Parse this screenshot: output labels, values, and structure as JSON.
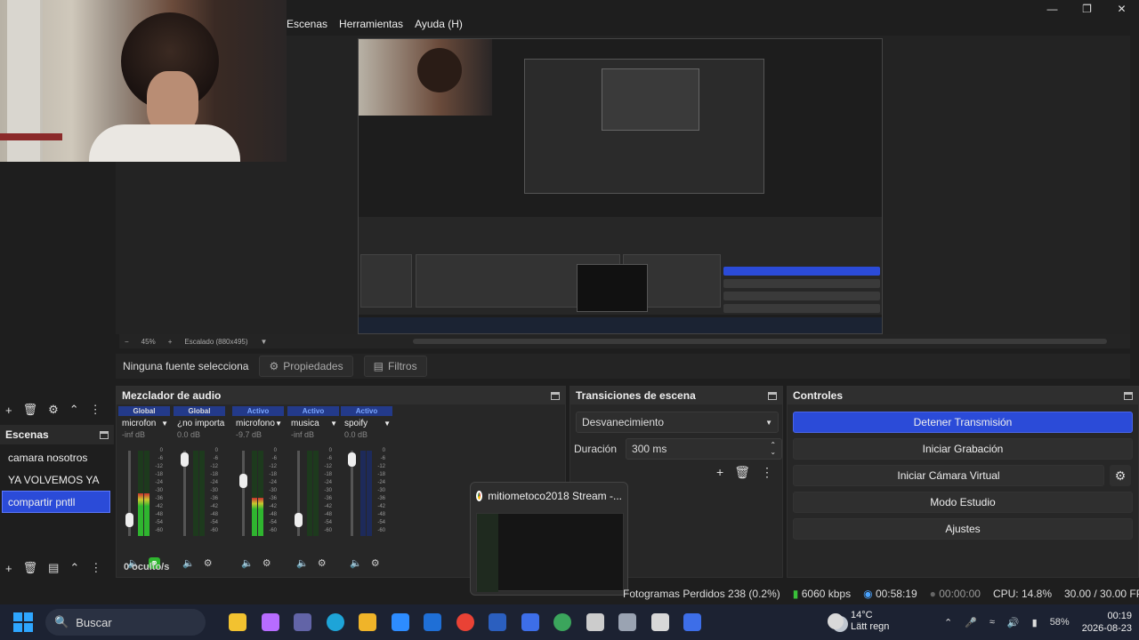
{
  "menu": [
    "Escenas",
    "Herramientas",
    "Ayuda (H)"
  ],
  "window_controls": [
    "minimize-icon",
    "maximize-icon",
    "close-icon"
  ],
  "preview": {
    "zoom": "45%",
    "scaling": "Escalado (880x495)"
  },
  "sources_toolbar": {
    "status": "Ninguna fuente selecciona",
    "properties": "Propiedades",
    "filters": "Filtros"
  },
  "scenes": {
    "title": "Escenas",
    "items": [
      "camara nosotros",
      "YA VOLVEMOS YA",
      "compartir pntll"
    ],
    "selected": 2
  },
  "mixer": {
    "title": "Mezclador de audio",
    "channels": [
      {
        "mode": "Global",
        "name": "microfon",
        "db": "-inf dB"
      },
      {
        "mode": "Global",
        "name": "¿no importa",
        "db": "0.0 dB"
      },
      {
        "mode": "Activo",
        "name": "microfono",
        "db": "-9.7 dB"
      },
      {
        "mode": "Activo",
        "name": "musica",
        "db": "-inf dB"
      },
      {
        "mode": "Activo",
        "name": "spoify",
        "db": "0.0 dB"
      }
    ],
    "scale": [
      "0",
      "-6",
      "-12",
      "-18",
      "-24",
      "-30",
      "-36",
      "-42",
      "-48",
      "-54",
      "-60"
    ],
    "hidden": "0 oculto/s"
  },
  "transitions": {
    "title": "Transiciones de escena",
    "selected": "Desvanecimiento",
    "duration_label": "Duración",
    "duration_value": "300 ms"
  },
  "controls": {
    "title": "Controles",
    "buttons": [
      "Detener Transmisión",
      "Iniciar Grabación",
      "Iniciar Cámara Virtual",
      "Modo Estudio",
      "Ajustes"
    ]
  },
  "hover_preview": {
    "title": "mitiometoco2018 Stream -..."
  },
  "status": {
    "dropped": "Fotogramas Perdidos 238 (0.2%)",
    "bitrate": "6060 kbps",
    "live_time": "00:58:19",
    "rec_time": "00:00:00",
    "cpu": "CPU: 14.8%",
    "fps": "30.00 / 30.00 FPS"
  },
  "taskbar": {
    "search": "Buscar",
    "weather_temp": "14°C",
    "weather_desc": "Lätt regn",
    "battery": "58%",
    "time": "00:19",
    "date": "2026-08-23",
    "apps": [
      {
        "name": "file-explorer-icon",
        "color": "#f2c230"
      },
      {
        "name": "copilot-icon",
        "color": "#b76cff"
      },
      {
        "name": "teams-icon",
        "color": "#6264a7"
      },
      {
        "name": "edge-icon",
        "color": "#1ea4d8"
      },
      {
        "name": "folder-icon",
        "color": "#f0b429"
      },
      {
        "name": "zoom-icon",
        "color": "#2d8cff"
      },
      {
        "name": "mail-icon",
        "color": "#1f6fd6"
      },
      {
        "name": "chrome-icon",
        "color": "#e94235"
      },
      {
        "name": "word-icon",
        "color": "#2b5fbf"
      },
      {
        "name": "teamviewer-icon",
        "color": "#3d6ee8"
      },
      {
        "name": "chrome-profile-icon",
        "color": "#3ba55c"
      },
      {
        "name": "inkscape-icon",
        "color": "#cccccc"
      },
      {
        "name": "settings-icon",
        "color": "#9aa3b2"
      },
      {
        "name": "obs-icon",
        "color": "#d8d8d8"
      },
      {
        "name": "teamviewer-2-icon",
        "color": "#3d6ee8"
      }
    ]
  }
}
